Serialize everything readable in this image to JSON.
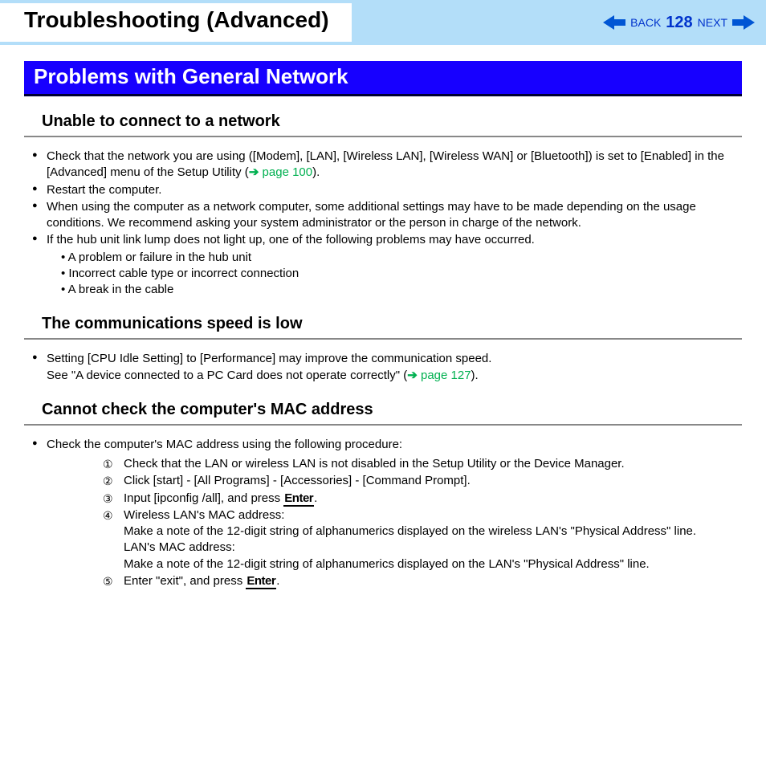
{
  "header": {
    "title": "Troubleshooting (Advanced)",
    "back": "BACK",
    "page": "128",
    "next": "NEXT"
  },
  "section_title": "Problems with General Network",
  "s1": {
    "heading": "Unable to connect to a network",
    "b1a": "Check that the network you are using ([Modem], [LAN], [Wireless LAN], [Wireless WAN] or [Bluetooth]) is set to [Enabled] in the [Advanced] menu of the Setup Utility (",
    "b1link": " page 100",
    "b1b": ").",
    "b2": "Restart the computer.",
    "b3": "When using the computer as a network computer, some additional settings may have to be made depending on the usage conditions. We recommend asking your system administrator or the person in charge of the network.",
    "b4": "If the hub unit link lump does not light up, one of the following problems may have occurred.",
    "b4s1": "•  A problem or failure in the hub unit",
    "b4s2": "•  Incorrect cable type or incorrect connection",
    "b4s3": "•  A break in the cable"
  },
  "s2": {
    "heading": "The communications speed is low",
    "b1line1": "Setting [CPU Idle Setting] to [Performance] may improve the communication speed.",
    "b1line2a": "See \"A device connected to a PC Card does not operate correctly\" (",
    "b1link": " page 127",
    "b1line2b": ")."
  },
  "s3": {
    "heading": "Cannot check the computer's MAC address",
    "b1": "Check the computer's MAC address using the following procedure:",
    "step1": "Check that the LAN or wireless LAN is not disabled in the Setup Utility or the Device Manager.",
    "step2": "Click [start] - [All Programs] - [Accessories] - [Command Prompt].",
    "step3a": "Input [ipconfig /all], and press ",
    "enter": "Enter",
    "step3b": ".",
    "step4a": "Wireless LAN's MAC address:",
    "step4b": "Make a note of the 12-digit string of alphanumerics displayed on the wireless LAN's \"Physical Address\" line.",
    "step4c": "LAN's MAC address:",
    "step4d": "Make a note of the 12-digit string of alphanumerics displayed on the LAN's \"Physical Address\" line.",
    "step5a": "Enter \"exit\", and press ",
    "step5b": "."
  }
}
